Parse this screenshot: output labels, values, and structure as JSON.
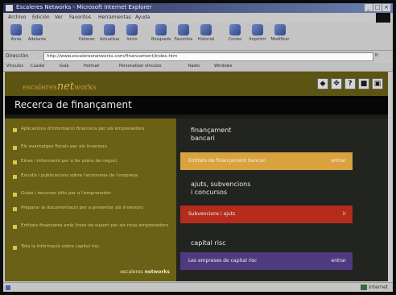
{
  "window": {
    "title": "Escaleres Networks - Microsoft Internet Explorer",
    "controls": [
      "_",
      "□",
      "×"
    ]
  },
  "menu": [
    "Archivo",
    "Edición",
    "Ver",
    "Favoritos",
    "Herramientas",
    "Ayuda"
  ],
  "toolbar": [
    "Atrás",
    "Adelante",
    "Detener",
    "Actualizar",
    "Inicio",
    "Búsqueda",
    "Favoritos",
    "Historial",
    "Correo",
    "Imprimir",
    "Modificar"
  ],
  "address": {
    "label": "Dirección",
    "url": "http://www.escaleresnetworks.com/financament/index.htm",
    "go": "Ir"
  },
  "links": [
    "Vínculos",
    "Cuadal",
    "Guía",
    "Hotmail",
    "Personalizar vínculos",
    "Radio",
    "Windows"
  ],
  "header": {
    "logo_pre": "escaleres",
    "logo_big": "net",
    "logo_post": "works",
    "icons": [
      "◆",
      "✥",
      "?",
      "■",
      "▣"
    ]
  },
  "page_title": "Recerca de finançament",
  "left_items": [
    "Aplicacions d'informació financera per als emprenedors",
    "Els avantatges fiscals per als inversors",
    "Eines i informació per a fer plans de negoci",
    "Estudis i publicacions sobre l'economia de l'empresa",
    "Guies i recursos útils per a l'emprenedor",
    "Preparar la documentació per a presentar als inversors",
    "Entitats financeres amb línies de suport per als nous emprenedors",
    "Tota la informació sobre capital risc"
  ],
  "credit": {
    "pre": "escaleres",
    "strong": "networks"
  },
  "sections": [
    {
      "heading": [
        "finançament",
        "bancari"
      ],
      "bar_left": "Entitats de finançament bancari",
      "bar_right": "entrar",
      "color": "#d9a23e"
    },
    {
      "heading": [
        "ajuts, subvencions",
        "i concursos"
      ],
      "bar_left": "Subvencions i ajuts",
      "bar_right": "ir",
      "color": "#b52b1c"
    },
    {
      "heading": [
        "capital risc"
      ],
      "bar_left": "Les empreses de capital risc",
      "bar_right": "entrar",
      "color": "#4f3a80"
    }
  ],
  "status": {
    "zone": "Internet"
  },
  "colors": {
    "header_bg": "#5c5412",
    "left_panel_bg": "#6a6016",
    "right_panel_bg": "#22241f",
    "bullet": "#e0c34a"
  }
}
